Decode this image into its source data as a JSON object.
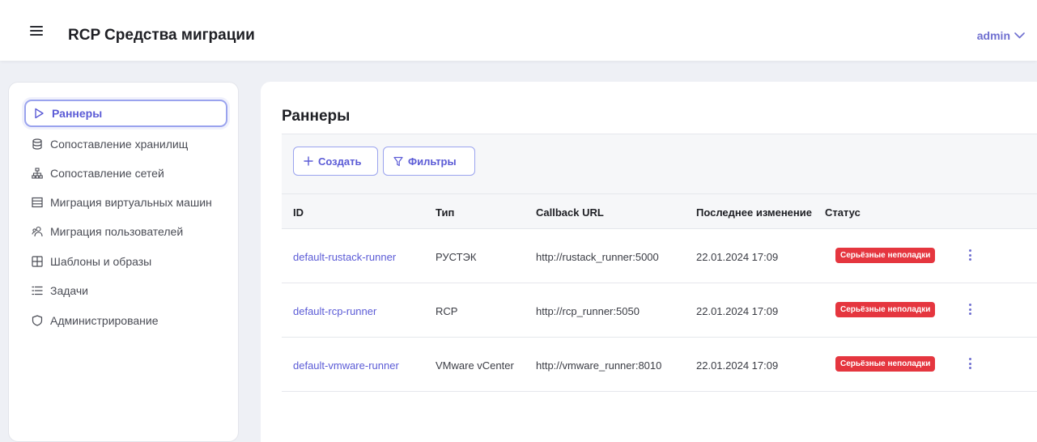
{
  "header": {
    "app_title": "RCP Средства миграции",
    "user": "admin",
    "menu_icon": "hamburger-icon",
    "user_icon": "chevron-down-icon"
  },
  "colors": {
    "accent": "#5b5bd6",
    "danger_badge": "#e5363f",
    "background": "#eef0f5"
  },
  "sidebar": {
    "items": [
      {
        "label": "Раннеры",
        "icon": "play-outline-icon",
        "active": true
      },
      {
        "label": "Сопоставление хранилищ",
        "icon": "database-icon",
        "active": false
      },
      {
        "label": "Сопоставление сетей",
        "icon": "network-icon",
        "active": false
      },
      {
        "label": "Миграция виртуальных машин",
        "icon": "server-icon",
        "active": false
      },
      {
        "label": "Миграция пользователей",
        "icon": "users-icon",
        "active": false
      },
      {
        "label": "Шаблоны и образы",
        "icon": "grid-icon",
        "active": false
      },
      {
        "label": "Задачи",
        "icon": "list-icon",
        "active": false
      },
      {
        "label": "Администрирование",
        "icon": "shield-icon",
        "active": false
      }
    ]
  },
  "main": {
    "title": "Раннеры",
    "toolbar": {
      "create_label": "Создать",
      "filter_label": "Фильтры"
    },
    "table": {
      "columns": [
        "ID",
        "Тип",
        "Callback URL",
        "Последнее изменение",
        "Статус"
      ],
      "rows": [
        {
          "id": "default-rustack-runner",
          "type": "РУСТЭК",
          "url": "http://rustack_runner:5000",
          "modified": "22.01.2024 17:09",
          "status": "Серьёзные неполадки"
        },
        {
          "id": "default-rcp-runner",
          "type": "RCP",
          "url": "http://rcp_runner:5050",
          "modified": "22.01.2024 17:09",
          "status": "Серьёзные неполадки"
        },
        {
          "id": "default-vmware-runner",
          "type": "VMware vCenter",
          "url": "http://vmware_runner:8010",
          "modified": "22.01.2024 17:09",
          "status": "Серьёзные неполадки"
        }
      ]
    }
  }
}
